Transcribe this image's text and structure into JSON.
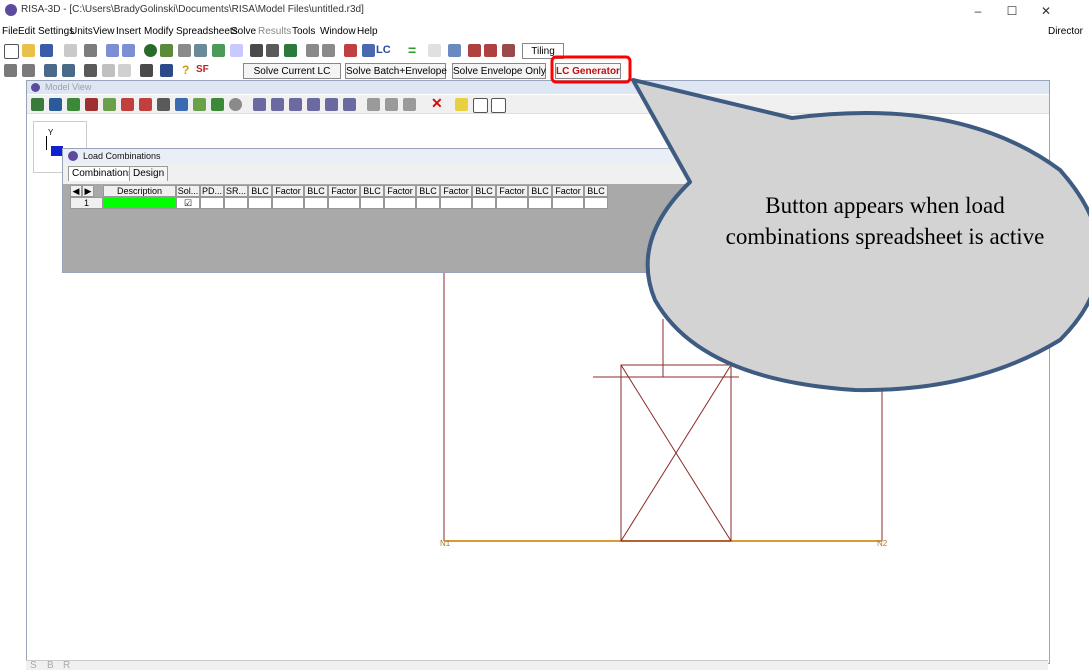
{
  "window": {
    "title": "RISA-3D - [C:\\Users\\BradyGolinski\\Documents\\RISA\\Model Files\\untitled.r3d]",
    "minimize": "–",
    "maximize": "☐",
    "close": "✕"
  },
  "menubar": {
    "items": [
      "File",
      "Edit",
      "Settings",
      "Units",
      "View",
      "Insert",
      "Modify",
      "Spreadsheets",
      "Solve",
      "Results",
      "Tools",
      "Window",
      "Help"
    ],
    "right": "Director"
  },
  "toolbar1": {
    "lc_label": "LC",
    "tiling": "Tiling"
  },
  "toolbar2": {
    "sf_label": "SF",
    "solve_current": "Solve Current LC",
    "solve_batch": "Solve Batch+Envelope",
    "solve_envelope": "Solve Envelope Only",
    "lc_generator": "LC Generator"
  },
  "model_view": {
    "title": "Model View",
    "axis_label": "Y",
    "nodes": [
      "N1",
      "N2"
    ]
  },
  "load_combinations": {
    "title": "Load Combinations",
    "tabs": [
      "Combinations",
      "Design"
    ],
    "columns": [
      "Description",
      "Sol...",
      "PD...",
      "SR...",
      "BLC",
      "Factor",
      "BLC",
      "Factor",
      "BLC",
      "Factor",
      "BLC",
      "Factor",
      "BLC",
      "Factor",
      "BLC",
      "Factor",
      "BLC"
    ],
    "rows": [
      {
        "num": "1",
        "solve_checked": "☑"
      }
    ]
  },
  "statusbar": {
    "letters": [
      "S",
      "B",
      "R"
    ]
  },
  "callout": {
    "text": "Button appears when load combinations spreadsheet is active"
  },
  "colors": {
    "highlight": "#ff0000",
    "callout_fill": "#d3d3d3",
    "callout_border": "#3e5b82",
    "member": "#8b2a2a",
    "base_line": "#d99a3c",
    "description_green": "#00ff00"
  }
}
